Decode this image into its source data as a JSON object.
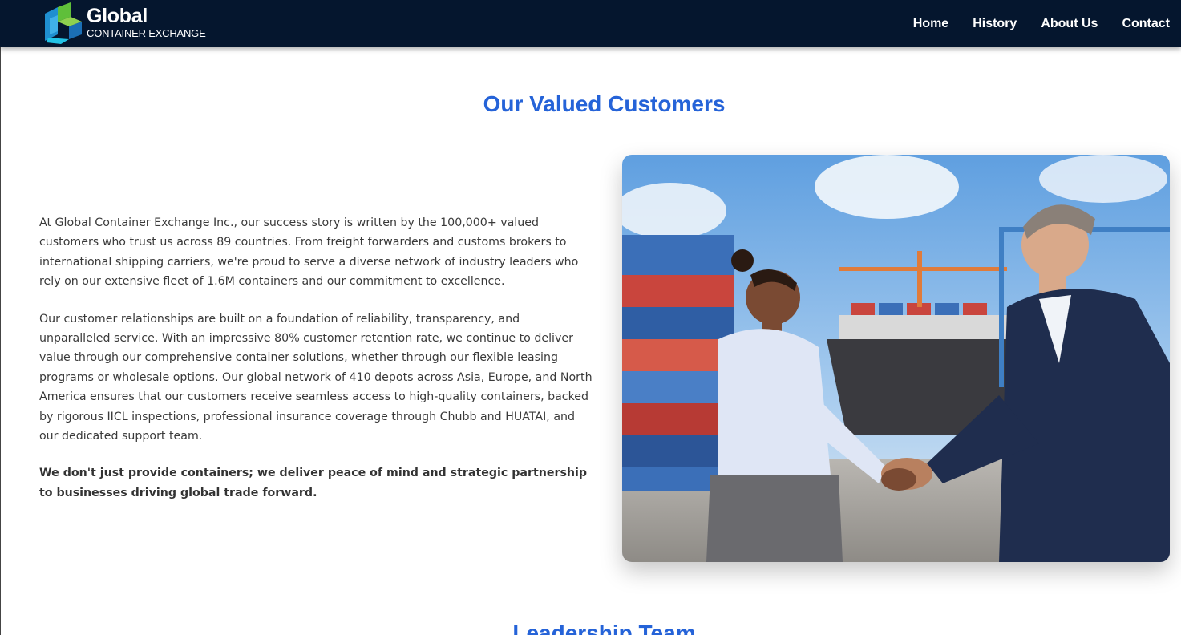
{
  "brand": {
    "name": "Global",
    "tagline": "CONTAINER EXCHANGE",
    "logo_icon": "cube-logo-icon",
    "colors": {
      "navy": "#05162e",
      "accent_blue": "#2563d8",
      "logo_green": "#5fbf3a",
      "logo_blue": "#1f8fd0"
    }
  },
  "nav": {
    "items": [
      {
        "label": "Home"
      },
      {
        "label": "History"
      },
      {
        "label": "About Us"
      },
      {
        "label": "Contact"
      }
    ]
  },
  "customers": {
    "title": "Our Valued Customers",
    "paragraphs": [
      "At Global Container Exchange Inc., our success story is written by the 100,000+ valued customers who trust us across 89 countries. From freight forwarders and customs brokers to international shipping carriers, we're proud to serve a diverse network of industry leaders who rely on our extensive fleet of 1.6M containers and our commitment to excellence.",
      "Our customer relationships are built on a foundation of reliability, transparency, and unparalleled service. With an impressive 80% customer retention rate, we continue to deliver value through our comprehensive container solutions, whether through our flexible leasing programs or wholesale options. Our global network of 410 depots across Asia, Europe, and North America ensures that our customers receive seamless access to high-quality containers, backed by rigorous IICL inspections, professional insurance coverage through Chubb and HUATAI, and our dedicated support team."
    ],
    "closing": "We don't just provide containers; we deliver peace of mind and strategic partnership to businesses driving global trade forward.",
    "image": "handshake-port-photo"
  },
  "leadership": {
    "title": "Leadership Team"
  }
}
